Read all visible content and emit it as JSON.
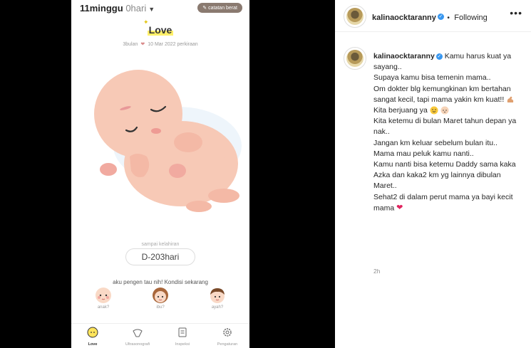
{
  "app": {
    "weeks": "11minggu",
    "days": "0hari",
    "weight_button": "catatan berat",
    "title": "Love",
    "subinfo_left": "3bulan",
    "subinfo_right": "10 Mar 2022 perkiraan",
    "countdown_label": "sampai kelahiran",
    "countdown_value": "D-203hari",
    "condition_label": "aku pengen tau nih! Kondisi sekarang",
    "faces": [
      {
        "label": "anak?",
        "icon": "baby-face-icon"
      },
      {
        "label": "ibu?",
        "icon": "mother-face-icon"
      },
      {
        "label": "ayah?",
        "icon": "father-face-icon"
      }
    ],
    "nav": [
      {
        "label": "Love",
        "icon": "baby-icon",
        "active": true
      },
      {
        "label": "Ultrasonografi",
        "icon": "ultrasound-icon",
        "active": false
      },
      {
        "label": "Inspeksi",
        "icon": "clipboard-icon",
        "active": false
      },
      {
        "label": "Pengaturan",
        "icon": "gear-icon",
        "active": false
      }
    ]
  },
  "instagram": {
    "username": "kalinaocktaranny",
    "follow_state": "Following",
    "caption_lines": [
      "Kamu harus kuat ya sayang..",
      "Supaya kamu bisa temenin mama..",
      "Om dokter blg kemungkinan km bertahan sangat kecil, tapi mama yakin km kuat!!",
      "Kita berjuang ya",
      "Kita ketemu di bulan Maret tahun depan ya nak..",
      "Jangan km keluar sebelum bulan itu..",
      "Mama mau peluk kamu nanti..",
      "Kamu nanti bisa ketemu Daddy sama kaka Azka dan kaka2 km yg lainnya dibulan Maret..",
      "Sehat2 di dalam perut mama ya bayi kecit mama"
    ],
    "time": "2h"
  }
}
